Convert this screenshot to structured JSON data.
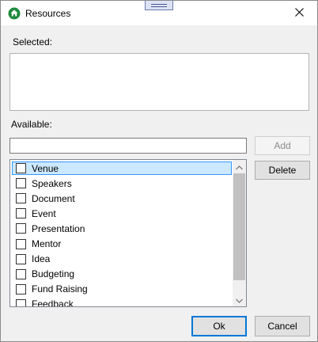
{
  "window": {
    "title": "Resources",
    "icon": "home-icon",
    "accent_color": "#0078d7"
  },
  "selected": {
    "label": "Selected:"
  },
  "available": {
    "label": "Available:",
    "search_value": "",
    "search_placeholder": ""
  },
  "buttons": {
    "add": "Add",
    "delete": "Delete",
    "ok": "Ok",
    "cancel": "Cancel"
  },
  "list": {
    "focused_index": 0,
    "items": [
      {
        "label": "Venue",
        "checked": false
      },
      {
        "label": "Speakers",
        "checked": false
      },
      {
        "label": "Document",
        "checked": false
      },
      {
        "label": "Event",
        "checked": false
      },
      {
        "label": "Presentation",
        "checked": false
      },
      {
        "label": "Mentor",
        "checked": false
      },
      {
        "label": "Idea",
        "checked": false
      },
      {
        "label": "Budgeting",
        "checked": false
      },
      {
        "label": "Fund Raising",
        "checked": false
      },
      {
        "label": "Feedback",
        "checked": false
      }
    ]
  }
}
